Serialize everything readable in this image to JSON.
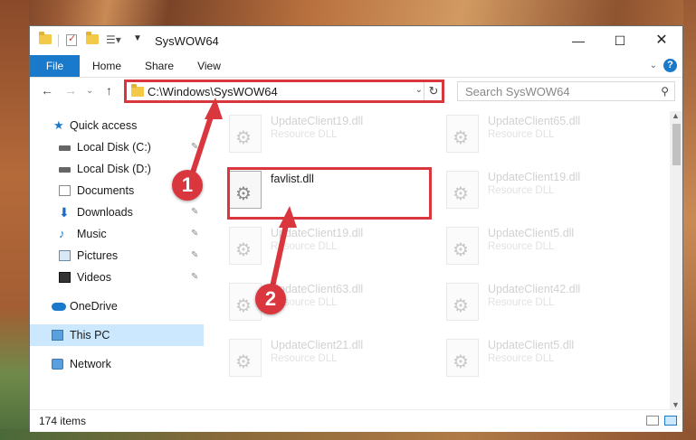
{
  "window": {
    "title": "SysWOW64",
    "min_glyph": "—",
    "max_glyph": "☐",
    "close_glyph": "✕"
  },
  "ribbon": {
    "tabs": [
      "File",
      "Home",
      "Share",
      "View"
    ],
    "expand_glyph": "⌄",
    "help_glyph": "?"
  },
  "nav": {
    "back_glyph": "←",
    "forward_glyph": "→",
    "recent_glyph": "⌄",
    "up_glyph": "↑",
    "address": "C:\\Windows\\SysWOW64",
    "address_dropdown_glyph": "⌄",
    "refresh_glyph": "↻",
    "search_placeholder": "Search SysWOW64",
    "search_glyph": "⚲"
  },
  "sidebar": {
    "items": [
      {
        "label": "Quick access",
        "icon": "star-icon",
        "pinned": false
      },
      {
        "label": "Local Disk (C:)",
        "icon": "drive-icon",
        "pinned": true
      },
      {
        "label": "Local Disk (D:)",
        "icon": "drive-icon",
        "pinned": false
      },
      {
        "label": "Documents",
        "icon": "documents-icon",
        "pinned": true
      },
      {
        "label": "Downloads",
        "icon": "downloads-icon",
        "pinned": true
      },
      {
        "label": "Music",
        "icon": "music-icon",
        "pinned": true
      },
      {
        "label": "Pictures",
        "icon": "pictures-icon",
        "pinned": true
      },
      {
        "label": "Videos",
        "icon": "videos-icon",
        "pinned": true
      },
      {
        "label": "OneDrive",
        "icon": "onedrive-icon",
        "pinned": false
      },
      {
        "label": "This PC",
        "icon": "this-pc-icon",
        "pinned": false,
        "selected": true
      },
      {
        "label": "Network",
        "icon": "network-icon",
        "pinned": false
      }
    ],
    "pin_glyph": "📌"
  },
  "files": [
    {
      "name": "UpdateClient19.dll",
      "type": "Resource DLL"
    },
    {
      "name": "UpdateClient65.dll",
      "type": "Resource DLL"
    },
    {
      "name": "favlist.dll",
      "type": ""
    },
    {
      "name": "UpdateClient19.dll",
      "type": "Resource DLL"
    },
    {
      "name": "UpdateClient19.dll",
      "type": "Resource DLL"
    },
    {
      "name": "UpdateClient5.dll",
      "type": "Resource DLL"
    },
    {
      "name": "UpdateClient63.dll",
      "type": "Resource DLL"
    },
    {
      "name": "UpdateClient42.dll",
      "type": "Resource DLL"
    },
    {
      "name": "UpdateClient21.dll",
      "type": "Resource DLL"
    },
    {
      "name": "UpdateClient5.dll",
      "type": "Resource DLL"
    }
  ],
  "status": {
    "item_count": "174 items"
  },
  "annotations": {
    "callout_1": "1",
    "callout_2": "2"
  },
  "colors": {
    "accent": "#1979ca",
    "highlight": "#d9363e",
    "selected_bg": "#cce8ff"
  }
}
